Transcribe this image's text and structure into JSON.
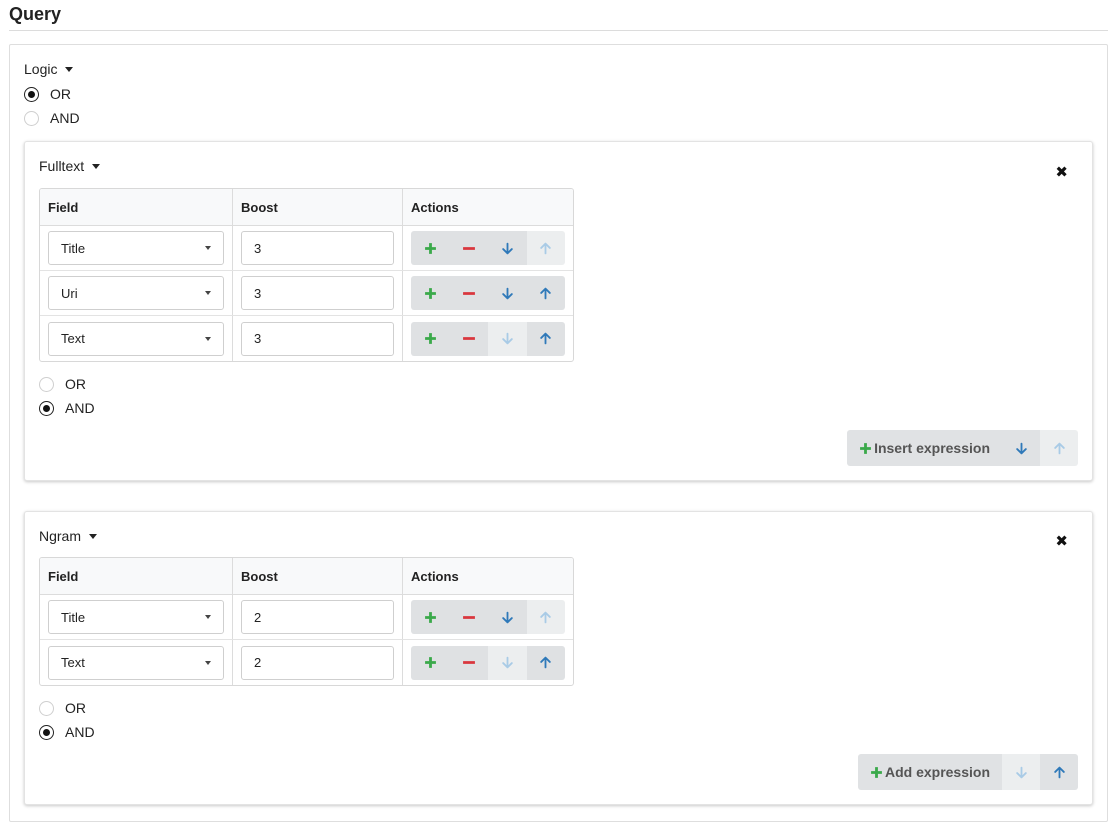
{
  "page": {
    "title": "Query"
  },
  "logic": {
    "label": "Logic",
    "options": [
      {
        "label": "OR",
        "checked": true
      },
      {
        "label": "AND",
        "checked": false
      }
    ]
  },
  "fulltext": {
    "label": "Fulltext",
    "close": "✖",
    "headers": {
      "field": "Field",
      "boost": "Boost",
      "actions": "Actions"
    },
    "rows": [
      {
        "field": "Title",
        "boost": "3",
        "down_enabled": true,
        "up_enabled": false
      },
      {
        "field": "Uri",
        "boost": "3",
        "down_enabled": true,
        "up_enabled": true
      },
      {
        "field": "Text",
        "boost": "3",
        "down_enabled": false,
        "up_enabled": true
      }
    ],
    "options": [
      {
        "label": "OR",
        "checked": false
      },
      {
        "label": "AND",
        "checked": true
      }
    ],
    "button_label": "Insert expression",
    "button_down_enabled": true,
    "button_up_enabled": false
  },
  "ngram": {
    "label": "Ngram",
    "close": "✖",
    "headers": {
      "field": "Field",
      "boost": "Boost",
      "actions": "Actions"
    },
    "rows": [
      {
        "field": "Title",
        "boost": "2",
        "down_enabled": true,
        "up_enabled": false
      },
      {
        "field": "Text",
        "boost": "2",
        "down_enabled": false,
        "up_enabled": true
      }
    ],
    "options": [
      {
        "label": "OR",
        "checked": false
      },
      {
        "label": "AND",
        "checked": true
      }
    ],
    "button_label": "Add expression",
    "button_down_enabled": false,
    "button_up_enabled": true
  },
  "colors": {
    "plus": "#3aa94a",
    "minus": "#d9363e",
    "arrow": "#2f79b9",
    "arrow_disabled": "#a9cbe6"
  },
  "icons": {
    "add": "plus-icon",
    "remove": "minus-icon",
    "down": "arrow-down-icon",
    "up": "arrow-up-icon",
    "close": "close-icon",
    "dropdown": "caret-down-icon"
  }
}
